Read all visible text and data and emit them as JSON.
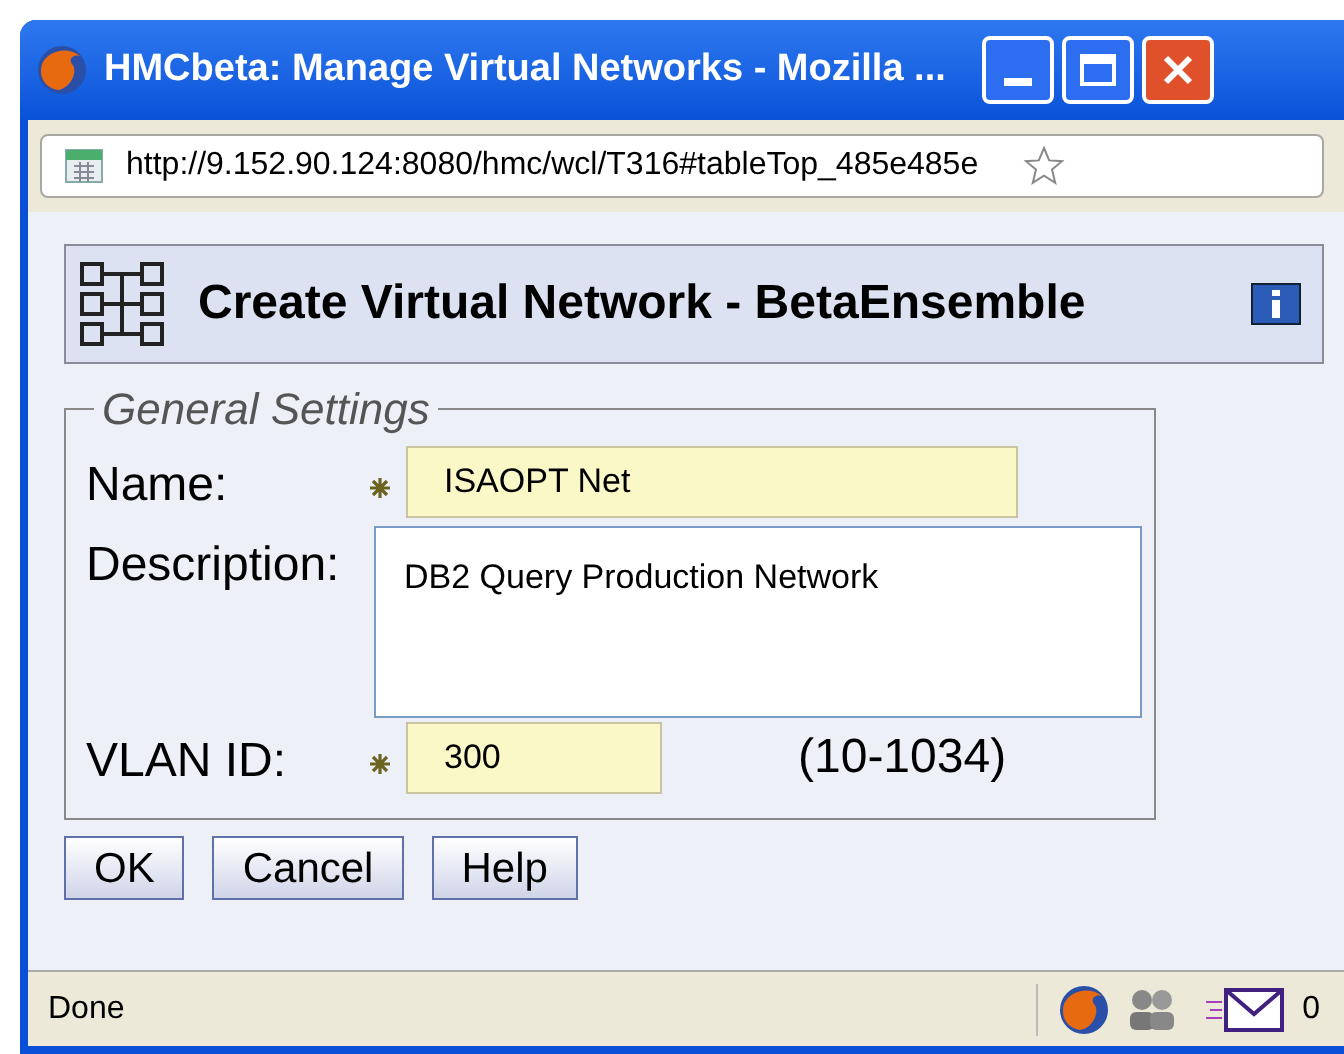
{
  "window": {
    "title": "HMCbeta: Manage Virtual Networks - Mozilla ..."
  },
  "address_bar": {
    "url": "http://9.152.90.124:8080/hmc/wcl/T316#tableTop_485e485e"
  },
  "dialog": {
    "title": "Create Virtual Network - BetaEnsemble"
  },
  "fieldset": {
    "legend": "General Settings",
    "fields": [
      {
        "kind": "input",
        "label": "Name:",
        "required": true,
        "value": "ISAOPT Net"
      },
      {
        "kind": "textarea",
        "label": "Description:",
        "required": false,
        "value": "DB2 Query Production Network"
      },
      {
        "kind": "input",
        "label": "VLAN ID:",
        "required": true,
        "value": "300",
        "hint": "(10-1034)"
      }
    ]
  },
  "buttons": [
    "OK",
    "Cancel",
    "Help"
  ],
  "status_bar": {
    "text": "Done",
    "mail_count": "0"
  }
}
